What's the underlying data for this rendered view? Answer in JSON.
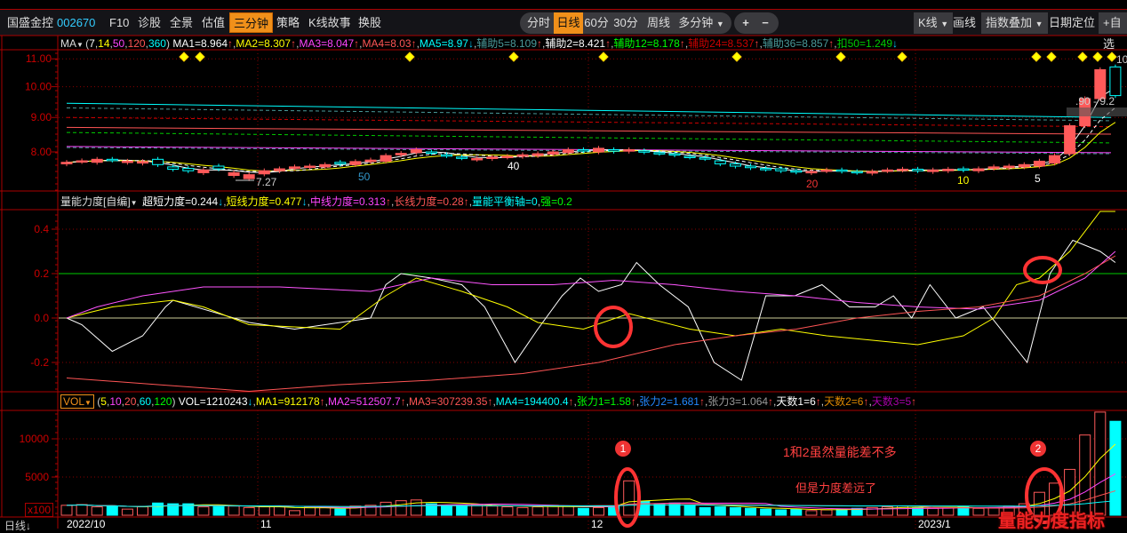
{
  "toolbar": {
    "stock_name": "国盛金控",
    "stock_code": "002670",
    "items": [
      "F10",
      "诊股",
      "全景",
      "估值",
      "三分钟",
      "策略",
      "K线故事",
      "换股"
    ],
    "active_item": "三分钟",
    "periods": [
      "分时",
      "日线",
      "60分",
      "30分",
      "周线",
      "多分钟"
    ],
    "active_period": "日线",
    "zoom_in": "+",
    "zoom_out": "−",
    "kline": "K线",
    "draw": "画线",
    "index_overlay": "指数叠加",
    "date_locate": "日期定位",
    "add_watch": "+自选"
  },
  "main_legend": {
    "name": "MA",
    "params": [
      {
        "t": "(",
        "c": "#ccc"
      },
      {
        "t": "7",
        "c": "#fff"
      },
      {
        "t": ",",
        "c": "#ccc"
      },
      {
        "t": "14",
        "c": "#ff0"
      },
      {
        "t": ",",
        "c": "#ccc"
      },
      {
        "t": "50",
        "c": "#f4f"
      },
      {
        "t": ",",
        "c": "#ccc"
      },
      {
        "t": "120",
        "c": "#f55"
      },
      {
        "t": ",",
        "c": "#ccc"
      },
      {
        "t": "360",
        "c": "#0ff"
      },
      {
        "t": ")",
        "c": "#ccc"
      }
    ],
    "items": [
      {
        "t": "MA1=8.964",
        "c": "#fff",
        "a": "↑"
      },
      {
        "t": "MA2=8.307",
        "c": "#ff0",
        "a": "↑"
      },
      {
        "t": "MA3=8.047",
        "c": "#f4f",
        "a": "↑"
      },
      {
        "t": "MA4=8.03",
        "c": "#f55",
        "a": "↑"
      },
      {
        "t": "MA5=8.97",
        "c": "#0ff",
        "a": "↓"
      },
      {
        "t": "辅助5=8.109",
        "c": "#4a9a9a",
        "a": "↑"
      },
      {
        "t": "辅助2=8.421",
        "c": "#fff",
        "a": "↑"
      },
      {
        "t": "辅助12=8.178",
        "c": "#0f0",
        "a": "↑"
      },
      {
        "t": "辅助24=8.537",
        "c": "#c00",
        "a": "↑"
      },
      {
        "t": "辅助36=8.857",
        "c": "#4a9a9a",
        "a": "↑"
      },
      {
        "t": "扣50=1.249",
        "c": "#0c0",
        "a": "↓"
      }
    ]
  },
  "ind_legend": {
    "name": "量能力度[自编]",
    "items": [
      {
        "t": "超短力度=0.244",
        "c": "#fff",
        "a": "↓"
      },
      {
        "t": "短线力度=0.477",
        "c": "#ff0",
        "a": "↓"
      },
      {
        "t": "中线力度=0.313",
        "c": "#f4f",
        "a": "↑"
      },
      {
        "t": "长线力度=0.28",
        "c": "#f55",
        "a": "↑"
      },
      {
        "t": "量能平衡轴=0",
        "c": "#0ff",
        "a": ""
      },
      {
        "t": "强=0.2",
        "c": "#0f0",
        "a": ""
      }
    ]
  },
  "vol_legend": {
    "name": "VOL",
    "params": [
      {
        "t": "(",
        "c": "#ccc"
      },
      {
        "t": "5",
        "c": "#ff0"
      },
      {
        "t": ",",
        "c": "#ccc"
      },
      {
        "t": "10",
        "c": "#f4f"
      },
      {
        "t": ",",
        "c": "#ccc"
      },
      {
        "t": "20",
        "c": "#f55"
      },
      {
        "t": ",",
        "c": "#ccc"
      },
      {
        "t": "60",
        "c": "#0ff"
      },
      {
        "t": ",",
        "c": "#ccc"
      },
      {
        "t": "120",
        "c": "#0f0"
      },
      {
        "t": ")",
        "c": "#ccc"
      }
    ],
    "items": [
      {
        "t": "VOL=1210243",
        "c": "#fff",
        "a": "↓"
      },
      {
        "t": "MA1=912178",
        "c": "#ff0",
        "a": "↑"
      },
      {
        "t": "MA2=512507.7",
        "c": "#f4f",
        "a": "↑"
      },
      {
        "t": "MA3=307239.35",
        "c": "#f55",
        "a": "↑"
      },
      {
        "t": "MA4=194400.4",
        "c": "#0ff",
        "a": "↑"
      },
      {
        "t": "张力1=1.58",
        "c": "#0f0",
        "a": "↑"
      },
      {
        "t": "张力2=1.681",
        "c": "#28f",
        "a": "↑"
      },
      {
        "t": "张力3=1.064",
        "c": "#999",
        "a": "↑"
      },
      {
        "t": "天数1=6",
        "c": "#fff",
        "a": "↑"
      },
      {
        "t": "天数2=6",
        "c": "#d80",
        "a": "↑"
      },
      {
        "t": "天数3=5",
        "c": "#a0a",
        "a": "↑"
      }
    ]
  },
  "axes": {
    "price_ticks": [
      "11.00",
      "10.00",
      "9.00",
      "8.00"
    ],
    "ind_ticks": [
      "0.4",
      "0.2",
      "0.0",
      "-0.2"
    ],
    "vol_ticks": [
      "10000",
      "5000"
    ],
    "vol_unit": "x100",
    "dates": [
      "2022/10",
      "11",
      "12",
      "2023/1"
    ],
    "period_label": "日线↓"
  },
  "price_marks": {
    "low": "7.27",
    "right_high": "10",
    "right_range": ".90 - 9.2",
    "ma_labels": [
      "50",
      "40",
      "20",
      "10",
      "5"
    ]
  },
  "annotations": {
    "badge1": "1",
    "badge2": "2",
    "note1": "1和2虽然量能差不多",
    "note2": "但是力度差远了",
    "watermark": "量能力度指标"
  },
  "colors": {
    "up": "#ff5a5a",
    "down": "#00ffff",
    "grid": "#a00000",
    "accent": "#f0901a"
  },
  "chart_data": {
    "type": "candlestick",
    "price_range": [
      7.1,
      11.2
    ],
    "candles_oc": [
      [
        7.68,
        7.72
      ],
      [
        7.74,
        7.76
      ],
      [
        7.72,
        7.8
      ],
      [
        7.8,
        7.78
      ],
      [
        7.72,
        7.75
      ],
      [
        7.7,
        7.74
      ],
      [
        7.8,
        7.66
      ],
      [
        7.6,
        7.54
      ],
      [
        7.56,
        7.5
      ],
      [
        7.45,
        7.52
      ],
      [
        7.62,
        7.55
      ],
      [
        7.38,
        7.45
      ],
      [
        7.3,
        7.4
      ],
      [
        7.42,
        7.5
      ],
      [
        7.5,
        7.55
      ],
      [
        7.56,
        7.6
      ],
      [
        7.6,
        7.62
      ],
      [
        7.6,
        7.66
      ],
      [
        7.72,
        7.68
      ],
      [
        7.66,
        7.74
      ],
      [
        7.74,
        7.78
      ],
      [
        7.75,
        7.9
      ],
      [
        7.92,
        7.96
      ],
      [
        7.98,
        8.06
      ],
      [
        8.0,
        7.98
      ],
      [
        7.92,
        7.9
      ],
      [
        7.86,
        7.84
      ],
      [
        7.8,
        7.82
      ],
      [
        7.82,
        7.86
      ],
      [
        7.86,
        7.88
      ],
      [
        7.88,
        7.92
      ],
      [
        7.9,
        7.95
      ],
      [
        7.94,
        8.0
      ],
      [
        7.98,
        8.06
      ],
      [
        8.06,
        8.03
      ],
      [
        8.0,
        8.1
      ],
      [
        8.06,
        8.02
      ],
      [
        8.02,
        8.06
      ],
      [
        8.03,
        8.0
      ],
      [
        7.98,
        7.96
      ],
      [
        7.95,
        7.92
      ],
      [
        7.88,
        7.86
      ],
      [
        7.84,
        7.82
      ],
      [
        7.76,
        7.68
      ],
      [
        7.68,
        7.62
      ],
      [
        7.62,
        7.58
      ],
      [
        7.56,
        7.54
      ],
      [
        7.55,
        7.5
      ],
      [
        7.5,
        7.47
      ],
      [
        7.45,
        7.48
      ],
      [
        7.5,
        7.52
      ],
      [
        7.52,
        7.49
      ],
      [
        7.48,
        7.46
      ],
      [
        7.44,
        7.48
      ],
      [
        7.5,
        7.52
      ],
      [
        7.52,
        7.54
      ],
      [
        7.54,
        7.5
      ],
      [
        7.48,
        7.52
      ],
      [
        7.5,
        7.54
      ],
      [
        7.55,
        7.52
      ],
      [
        7.5,
        7.55
      ],
      [
        7.56,
        7.6
      ],
      [
        7.58,
        7.62
      ],
      [
        7.6,
        7.66
      ],
      [
        7.62,
        7.75
      ],
      [
        7.7,
        7.9
      ],
      [
        7.95,
        8.75
      ],
      [
        8.75,
        9.6
      ],
      [
        9.6,
        10.6
      ],
      [
        10.7,
        9.7
      ]
    ],
    "volume": [
      1300,
      1400,
      1100,
      1200,
      800,
      1100,
      1600,
      1500,
      1500,
      1100,
      1100,
      1200,
      1000,
      1100,
      1100,
      600,
      1100,
      1000,
      800,
      1200,
      1300,
      1700,
      1900,
      2000,
      1500,
      1200,
      1300,
      1400,
      1200,
      1100,
      1000,
      1100,
      1300,
      1200,
      900,
      1000,
      1200,
      4500,
      1800,
      1400,
      1600,
      1300,
      1000,
      1100,
      1000,
      900,
      800,
      700,
      800,
      600,
      700,
      800,
      900,
      1000,
      1100,
      1200,
      1000,
      900,
      1000,
      1100,
      900,
      1000,
      1200,
      1500,
      3000,
      4200,
      6000,
      10500,
      13500,
      12300
    ],
    "indicator_series": [
      {
        "name": "超短力度",
        "color": "#ffffff",
        "points": [
          [
            0,
            0
          ],
          [
            1,
            -0.03
          ],
          [
            3,
            -0.15
          ],
          [
            5,
            -0.08
          ],
          [
            6.5,
            0.05
          ],
          [
            7,
            0.08
          ],
          [
            12,
            -0.02
          ],
          [
            15,
            -0.05
          ],
          [
            18,
            -0.02
          ],
          [
            20,
            0
          ],
          [
            21,
            0.15
          ],
          [
            22,
            0.2
          ],
          [
            24,
            0.18
          ],
          [
            26,
            0.15
          ],
          [
            27.5,
            0.05
          ],
          [
            29.5,
            -0.2
          ],
          [
            31,
            -0.05
          ],
          [
            32.6,
            0.1
          ],
          [
            33.8,
            0.18
          ],
          [
            35,
            0.12
          ],
          [
            36.5,
            0.15
          ],
          [
            37.5,
            0.25
          ],
          [
            39,
            0.15
          ],
          [
            40.9,
            0.05
          ],
          [
            42.6,
            -0.2
          ],
          [
            44.4,
            -0.28
          ],
          [
            46,
            0.1
          ],
          [
            47.9,
            0.1
          ],
          [
            49.7,
            0.15
          ],
          [
            51.5,
            0.05
          ],
          [
            53.2,
            0.05
          ],
          [
            54.4,
            0.1
          ],
          [
            55.6,
            0
          ],
          [
            56.8,
            0.15
          ],
          [
            58.5,
            0
          ],
          [
            60.3,
            0.05
          ],
          [
            63.2,
            -0.2
          ],
          [
            64.7,
            0.2
          ],
          [
            66.2,
            0.35
          ],
          [
            68,
            0.3
          ],
          [
            69,
            0.25
          ]
        ]
      },
      {
        "name": "短线力度",
        "color": "#ffff00",
        "points": [
          [
            0,
            0
          ],
          [
            3,
            0.05
          ],
          [
            7,
            0.08
          ],
          [
            9,
            0.05
          ],
          [
            12,
            -0.03
          ],
          [
            18,
            -0.05
          ],
          [
            21,
            0.1
          ],
          [
            23,
            0.18
          ],
          [
            26,
            0.12
          ],
          [
            29,
            0.05
          ],
          [
            31,
            -0.02
          ],
          [
            34,
            -0.05
          ],
          [
            37,
            0.02
          ],
          [
            41,
            -0.05
          ],
          [
            44,
            -0.08
          ],
          [
            47,
            -0.05
          ],
          [
            50,
            -0.08
          ],
          [
            53,
            -0.1
          ],
          [
            56,
            -0.12
          ],
          [
            59,
            -0.08
          ],
          [
            61,
            0
          ],
          [
            62.5,
            0.15
          ],
          [
            64,
            0.18
          ],
          [
            66,
            0.3
          ],
          [
            68,
            0.48
          ],
          [
            69,
            0.48
          ]
        ]
      },
      {
        "name": "中线力度",
        "color": "#ff55ff",
        "points": [
          [
            0,
            0
          ],
          [
            2,
            0.05
          ],
          [
            5,
            0.1
          ],
          [
            9,
            0.14
          ],
          [
            14,
            0.14
          ],
          [
            20,
            0.12
          ],
          [
            24,
            0.18
          ],
          [
            28,
            0.15
          ],
          [
            32,
            0.15
          ],
          [
            36,
            0.17
          ],
          [
            40,
            0.15
          ],
          [
            44,
            0.12
          ],
          [
            48,
            0.1
          ],
          [
            52,
            0.07
          ],
          [
            56,
            0.05
          ],
          [
            60,
            0.04
          ],
          [
            64,
            0.08
          ],
          [
            67,
            0.18
          ],
          [
            69,
            0.3
          ]
        ]
      },
      {
        "name": "长线力度",
        "color": "#ff5555",
        "points": [
          [
            0,
            -0.27
          ],
          [
            6,
            -0.3
          ],
          [
            12,
            -0.33
          ],
          [
            18,
            -0.3
          ],
          [
            24,
            -0.28
          ],
          [
            30,
            -0.25
          ],
          [
            35,
            -0.2
          ],
          [
            40,
            -0.12
          ],
          [
            44,
            -0.08
          ],
          [
            48,
            -0.05
          ],
          [
            52,
            0
          ],
          [
            56,
            0.03
          ],
          [
            60,
            0.05
          ],
          [
            64,
            0.1
          ],
          [
            67,
            0.2
          ],
          [
            69,
            0.28
          ]
        ]
      }
    ],
    "indicator_levels": {
      "strong": 0.2,
      "balance": 0
    },
    "indicator_range": [
      -0.42,
      0.48
    ]
  }
}
